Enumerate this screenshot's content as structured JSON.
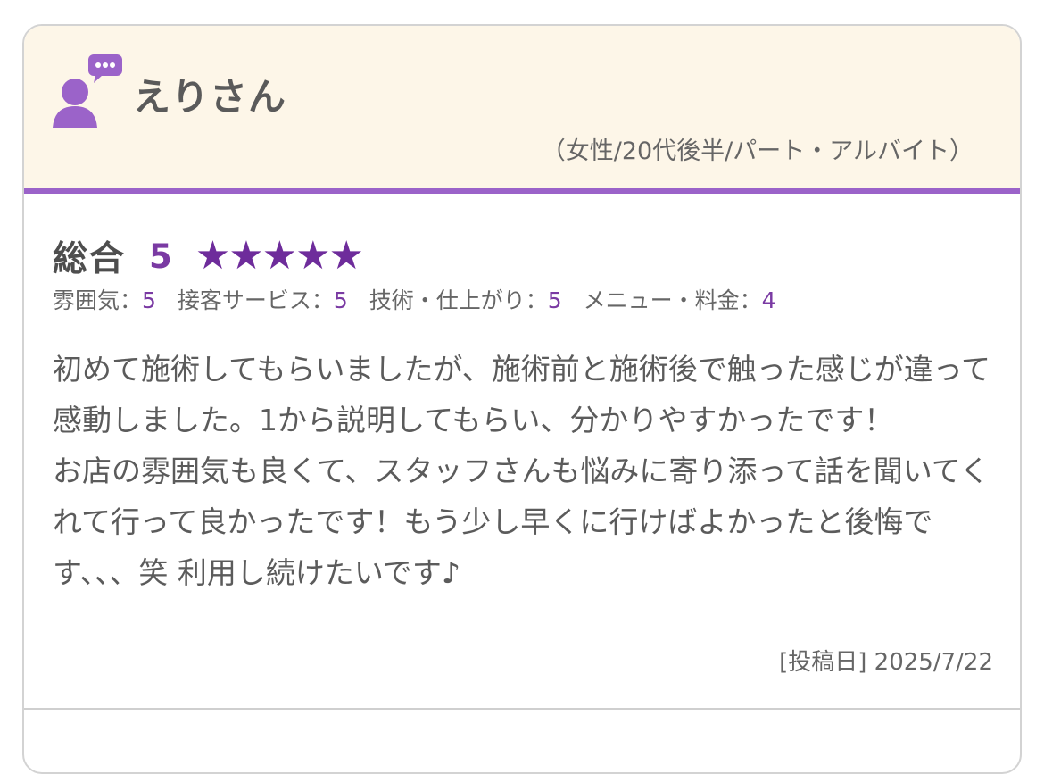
{
  "reviewer": {
    "name": "えりさん",
    "profile": "（女性/20代後半/パート・アルバイト）",
    "avatar_icon": "person-speech-bubble-icon"
  },
  "rating": {
    "overall_label": "総合",
    "overall_score": "5",
    "stars_display": "★★★★★",
    "stars_value": 5,
    "stars_max": 5,
    "subs": [
      {
        "label": "雰囲気：",
        "value": "5"
      },
      {
        "label": "接客サービス：",
        "value": "5"
      },
      {
        "label": "技術・仕上がり：",
        "value": "5"
      },
      {
        "label": "メニュー・料金：",
        "value": "4"
      }
    ]
  },
  "comment": {
    "para1": "初めて施術してもらいましたが、施術前と施術後で触った感じが違って感動しました。1から説明してもらい、分かりやすかったです！",
    "para2": "お店の雰囲気も良くて、スタッフさんも悩みに寄り添って話を聞いてくれて行って良かったです！もう少し早くに行けばよかったと後悔です、、、笑 利用し続けたいです♪"
  },
  "post_date": "[投稿日] 2025/7/22",
  "colors": {
    "accent": "#9b63c9",
    "star": "#6e2c9b",
    "header_bg": "#fdf6e8"
  }
}
